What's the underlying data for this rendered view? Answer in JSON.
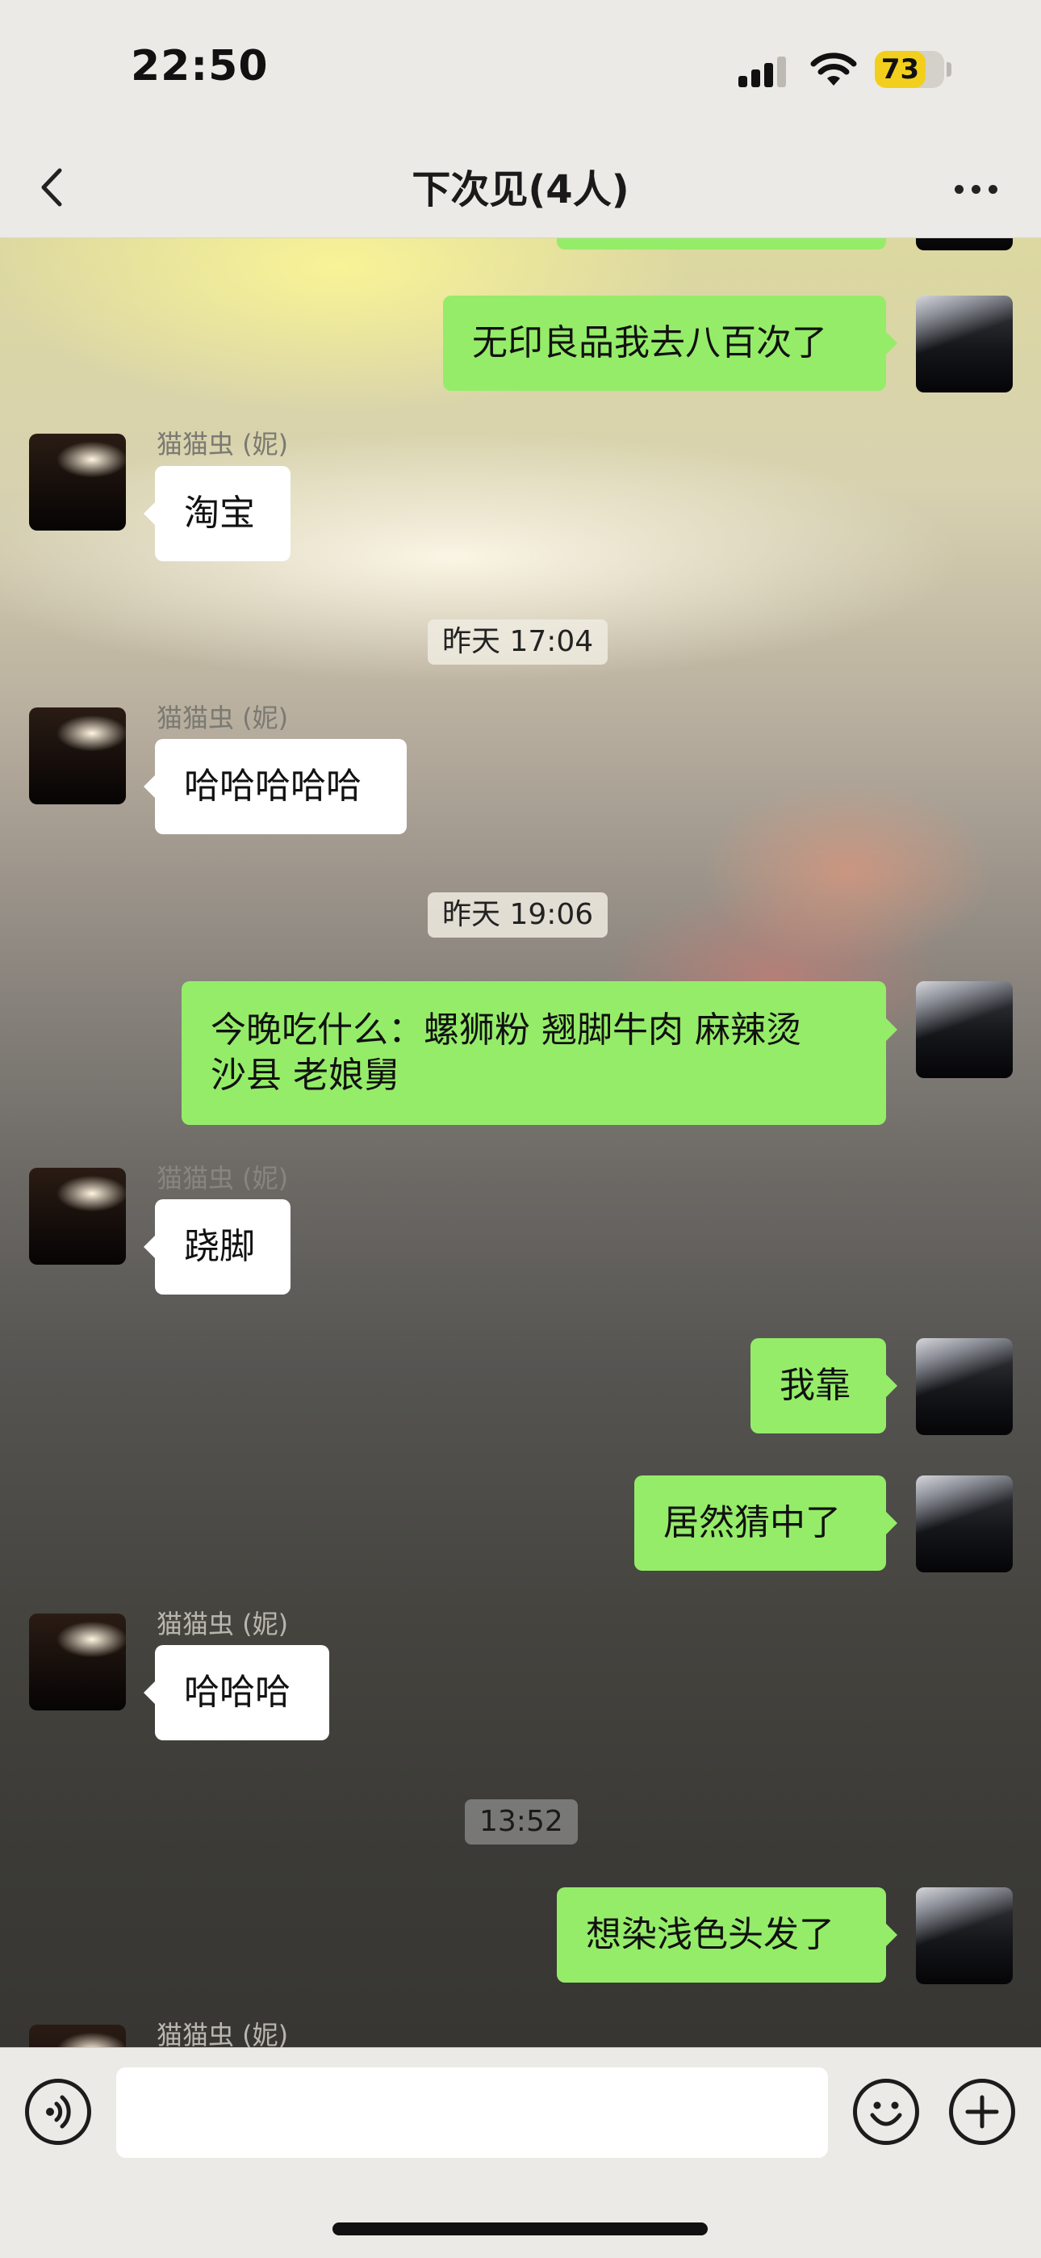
{
  "status_bar": {
    "time": "22:50",
    "battery": "73"
  },
  "header": {
    "title": "下次见(4人)"
  },
  "messages": {
    "m1": "无印良品我去八百次了",
    "m2_sender": "猫猫虫 (妮)",
    "m2": "淘宝",
    "t1": "昨天 17:04",
    "m3_sender": "猫猫虫 (妮)",
    "m3": "哈哈哈哈哈",
    "t2": "昨天 19:06",
    "m4_line1": "今晚吃什么：螺狮粉 翘脚牛肉 麻辣烫",
    "m4_line2": "沙县 老娘舅",
    "m5_sender": "猫猫虫 (妮)",
    "m5": "跷脚",
    "m6": "我靠",
    "m7": "居然猜中了",
    "m8_sender": "猫猫虫 (妮)",
    "m8": "哈哈哈",
    "t3": "13:52",
    "m9": "想染浅色头发了",
    "m10_sender": "猫猫虫 (妮)"
  },
  "icons": {
    "back": "chevron-left-icon",
    "more": "more-dots-icon",
    "voice": "voice-icon",
    "emoji": "emoji-icon",
    "plus": "plus-icon"
  },
  "colors": {
    "bubble_me": "#95ec69",
    "bubble_other": "#ffffff",
    "battery": "#f3cf1d"
  }
}
